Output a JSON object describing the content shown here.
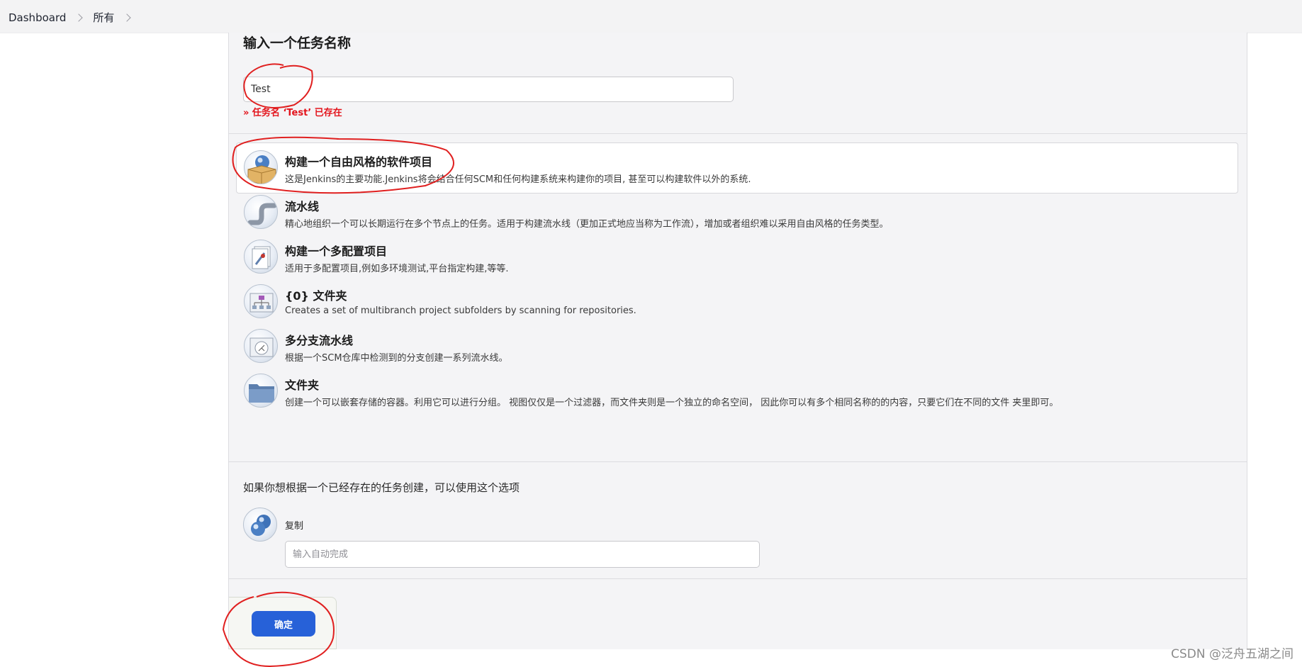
{
  "breadcrumb": {
    "items": [
      "Dashboard",
      "所有"
    ]
  },
  "form": {
    "title": "输入一个任务名称",
    "name_value": "Test",
    "name_error": "» 任务名 ‘Test’ 已存在"
  },
  "job_types": [
    {
      "title": "构建一个自由风格的软件项目",
      "desc": "这是Jenkins的主要功能.Jenkins将会结合任何SCM和任何构建系统来构建你的项目, 甚至可以构建软件以外的系统.",
      "icon": "freestyle-package-icon",
      "selected": true
    },
    {
      "title": "流水线",
      "desc": "精心地组织一个可以长期运行在多个节点上的任务。适用于构建流水线（更加正式地应当称为工作流），增加或者组织难以采用自由风格的任务类型。",
      "icon": "pipeline-icon"
    },
    {
      "title": "构建一个多配置项目",
      "desc": "适用于多配置项目,例如多环境测试,平台指定构建,等等.",
      "icon": "multi-config-icon"
    },
    {
      "title": "{0} 文件夹",
      "desc": "Creates a set of multibranch project subfolders by scanning for repositories.",
      "icon": "org-folder-icon"
    },
    {
      "title": "多分支流水线",
      "desc": "根据一个SCM仓库中检测到的分支创建一系列流水线。",
      "icon": "multibranch-pipeline-icon"
    },
    {
      "title": "文件夹",
      "desc": "创建一个可以嵌套存储的容器。利用它可以进行分组。 视图仅仅是一个过滤器，而文件夹则是一个独立的命名空间， 因此你可以有多个相同名称的的内容，只要它们在不同的文件 夹里即可。",
      "icon": "folder-icon"
    }
  ],
  "copy": {
    "hint": "如果你想根据一个已经存在的任务创建，可以使用这个选项",
    "label": "复制",
    "placeholder": "输入自动完成"
  },
  "ok_button": {
    "label": "确定"
  },
  "watermark": "CSDN @泛舟五湖之间",
  "colors": {
    "accent": "#2761d8",
    "error": "#e3141c",
    "annotation": "#e02020"
  }
}
